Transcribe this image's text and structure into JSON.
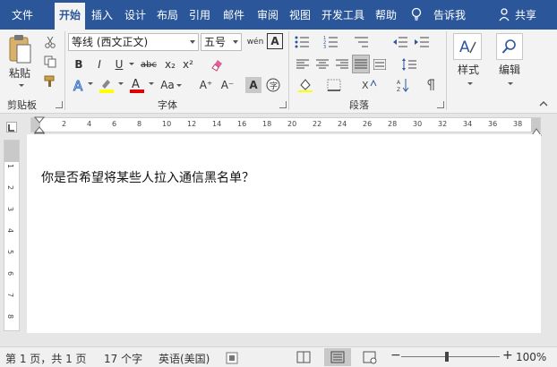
{
  "tabs": [
    {
      "label": "文件"
    },
    {
      "label": "开始",
      "active": true
    },
    {
      "label": "插入"
    },
    {
      "label": "设计"
    },
    {
      "label": "布局"
    },
    {
      "label": "引用"
    },
    {
      "label": "邮件"
    },
    {
      "label": "审阅"
    },
    {
      "label": "视图"
    },
    {
      "label": "开发工具"
    },
    {
      "label": "帮助"
    },
    {
      "label": "告诉我"
    }
  ],
  "share_label": "共享",
  "clipboard": {
    "paste_label": "粘贴",
    "group_label": "剪贴板"
  },
  "font": {
    "name": "等线 (西文正文)",
    "size": "五号",
    "group_label": "字体",
    "bold": "B",
    "italic": "I",
    "underline": "U",
    "strike": "abc",
    "subscript": "x₂",
    "superscript": "x²",
    "grow": "A⁺",
    "shrink": "A⁻",
    "case": "Aa",
    "phonetic": "wén",
    "border_char": "A"
  },
  "paragraph": {
    "group_label": "段落"
  },
  "styles": {
    "label": "样式"
  },
  "editing": {
    "label": "编辑"
  },
  "ruler": {
    "top_ticks": [
      "2",
      "4",
      "6",
      "8",
      "10",
      "12",
      "14",
      "16",
      "18",
      "20",
      "22",
      "24",
      "26",
      "28",
      "30",
      "32",
      "34",
      "36",
      "38"
    ],
    "left_ticks": [
      "1",
      "2",
      "3",
      "4",
      "5",
      "6",
      "7",
      "8"
    ]
  },
  "document": {
    "text": "你是否希望将某些人拉入通信黑名单？"
  },
  "status": {
    "page": "第 1 页，共 1 页",
    "words": "17 个字",
    "language": "英语(美国)",
    "zoom": "100%"
  },
  "colors": {
    "accent": "#2b579a",
    "highlight": "#ffff00",
    "font_color": "#e00000",
    "ribbon_bg": "#f3f3f3"
  }
}
